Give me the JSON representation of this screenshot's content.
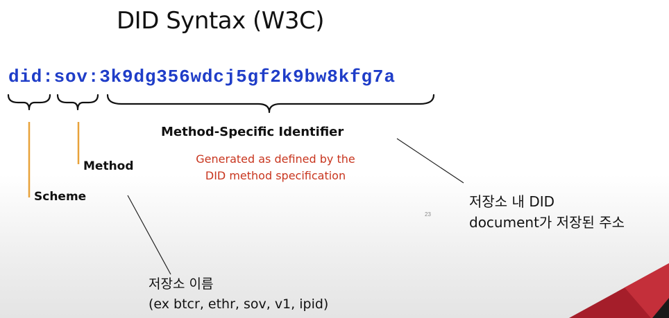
{
  "slide": {
    "title": "DID Syntax (W3C)",
    "did_scheme": "did",
    "did_sep1": ":",
    "did_method": "sov",
    "did_sep2": ":",
    "did_identifier": "3k9dg356wdcj5gf2k9bw8kfg7a",
    "scheme_label": "Scheme",
    "method_label": "Method",
    "msi_label": "Method-Specific Identifier",
    "msi_note_line1": "Generated as defined by the",
    "msi_note_line2": "DID method specification",
    "page_number": "23"
  },
  "annotations": {
    "right_line1": "저장소 내 DID",
    "right_line2": "document가 저장된 주소",
    "bottom_line1": "저장소 이름",
    "bottom_line2": "(ex btcr, ethr, sov, v1, ipid)"
  },
  "colors": {
    "did_text": "#1f3dc8",
    "note_red": "#c8351e",
    "pointer_orange": "#e8a23a",
    "corner_red": "#b3232f"
  }
}
